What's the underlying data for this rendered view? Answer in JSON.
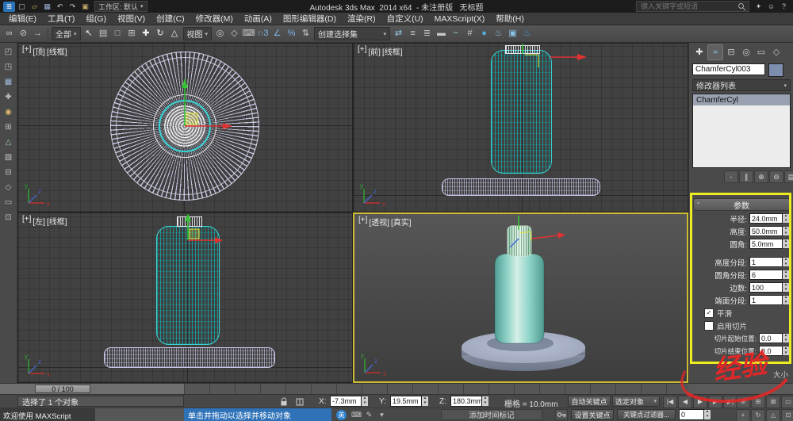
{
  "ui": {
    "caret": "▾",
    "spin_up": "▴",
    "spin_down": "▾",
    "minus": "-"
  },
  "titlebar": {
    "icons_left": [
      {
        "name": "app-menu-icon",
        "glyph": "≣",
        "color": "#ffffff",
        "bg": "#2a72b5"
      },
      {
        "name": "new-scene-icon",
        "glyph": "▢",
        "color": "#c8c8c8"
      },
      {
        "name": "open-file-icon",
        "glyph": "▱",
        "color": "#d8b868"
      },
      {
        "name": "save-icon",
        "glyph": "▦",
        "color": "#9ab0d0"
      },
      {
        "name": "undo-icon",
        "glyph": "↶",
        "color": "#c8c8c8"
      },
      {
        "name": "redo-icon",
        "glyph": "↷",
        "color": "#c8c8c8"
      },
      {
        "name": "fetch-icon",
        "glyph": "▣",
        "color": "#c0a868"
      }
    ],
    "workspace_label": "工作区: 默认",
    "title": "Autodesk 3ds Max  2014 x64  - 未注册版   无标题",
    "search_placeholder": "键入关键字或短语",
    "icons_right": [
      {
        "name": "sign-in-key-icon",
        "glyph": "✦",
        "color": "#c8c8c8"
      },
      {
        "name": "community-icon",
        "glyph": "☺",
        "color": "#c8c8c8"
      },
      {
        "name": "help-icon",
        "glyph": "?",
        "color": "#c8c8c8"
      }
    ]
  },
  "menubar": {
    "items": [
      "编辑(E)",
      "工具(T)",
      "组(G)",
      "视图(V)",
      "创建(C)",
      "修改器(M)",
      "动画(A)",
      "图形编辑器(D)",
      "渲染(R)",
      "自定义(U)",
      "MAXScript(X)",
      "帮助(H)"
    ]
  },
  "toolbar": {
    "icons_a": [
      {
        "name": "select-and-link-icon",
        "glyph": "∞",
        "color": "#c8c8c8"
      },
      {
        "name": "unlink-selection-icon",
        "glyph": "⊘",
        "color": "#c8c8c8"
      },
      {
        "name": "bind-to-space-warp-icon",
        "glyph": "→",
        "color": "#c8c8c8"
      }
    ],
    "selection_filter": "全部",
    "icons_b": [
      {
        "name": "select-object-icon",
        "glyph": "↖",
        "color": "#f0f0f0"
      },
      {
        "name": "select-by-name-icon",
        "glyph": "▤",
        "color": "#c8c8c8"
      },
      {
        "name": "rectangular-selection-region-icon",
        "glyph": "□",
        "color": "#c8c8c8"
      },
      {
        "name": "window-crossing-toggle-icon",
        "glyph": "⊞",
        "color": "#c8c8c8"
      },
      {
        "name": "select-and-move-icon",
        "glyph": "✚",
        "color": "#f0f0f0"
      },
      {
        "name": "select-and-rotate-icon",
        "glyph": "↻",
        "color": "#f0f0f0"
      },
      {
        "name": "select-and-scale-icon",
        "glyph": "△",
        "color": "#f0f0f0"
      }
    ],
    "reference_coordinate": "视图",
    "icons_c": [
      {
        "name": "use-pivot-center-icon",
        "glyph": "◎",
        "color": "#c8c8c8"
      },
      {
        "name": "select-and-manipulate-icon",
        "glyph": "◇",
        "color": "#c8c8c8"
      },
      {
        "name": "keyboard-shortcut-override-icon",
        "glyph": "⌨",
        "color": "#c8c8c8"
      },
      {
        "name": "snaps-toggle-icon",
        "glyph": "∩3",
        "color": "#7ab4e8"
      },
      {
        "name": "angle-snap-icon",
        "glyph": "∠",
        "color": "#7ab4e8"
      },
      {
        "name": "percent-snap-icon",
        "glyph": "%",
        "color": "#7ab4e8"
      },
      {
        "name": "spinner-snap-icon",
        "glyph": "⇅",
        "color": "#c8c8c8"
      }
    ],
    "named_selection": "创建选择集",
    "icons_d": [
      {
        "name": "mirror-icon",
        "glyph": "⇄",
        "color": "#9ad0e8"
      },
      {
        "name": "align-icon",
        "glyph": "≡",
        "color": "#c8c8c8"
      },
      {
        "name": "layer-manager-icon",
        "glyph": "≣",
        "color": "#c8c8c8"
      },
      {
        "name": "ribbon-toggle-icon",
        "glyph": "▬",
        "color": "#c8c8c8"
      },
      {
        "name": "curve-editor-icon",
        "glyph": "~",
        "color": "#9ae89a"
      },
      {
        "name": "schematic-view-icon",
        "glyph": "#",
        "color": "#c8c8c8"
      },
      {
        "name": "material-editor-icon",
        "glyph": "●",
        "color": "#58a8d8"
      },
      {
        "name": "render-setup-icon",
        "glyph": "♨",
        "color": "#88c0e8"
      },
      {
        "name": "rendered-frame-icon",
        "glyph": "▣",
        "color": "#88c0e8"
      },
      {
        "name": "render-production-icon",
        "glyph": "♨",
        "color": "#4a9ad8"
      }
    ]
  },
  "leftstrip": {
    "icons": [
      {
        "name": "left-dock-icon",
        "glyph": "◰",
        "color": "#c0c0c0"
      },
      {
        "name": "left-dock-icon",
        "glyph": "◳",
        "color": "#c0c0c0"
      },
      {
        "name": "left-dock-icon",
        "glyph": "▦",
        "color": "#9ab8d8"
      },
      {
        "name": "left-dock-icon",
        "glyph": "✚",
        "color": "#c0c0c0"
      },
      {
        "name": "left-dock-icon",
        "glyph": "◉",
        "color": "#d8b868"
      },
      {
        "name": "left-dock-icon",
        "glyph": "⊞",
        "color": "#c0c0c0"
      },
      {
        "name": "left-dock-icon",
        "glyph": "△",
        "color": "#9ad09a"
      },
      {
        "name": "left-dock-icon",
        "glyph": "▧",
        "color": "#c0c0c0"
      },
      {
        "name": "left-dock-icon",
        "glyph": "⊟",
        "color": "#c0c0c0"
      },
      {
        "name": "left-dock-icon",
        "glyph": "◇",
        "color": "#c0c0c0"
      },
      {
        "name": "left-dock-icon",
        "glyph": "▭",
        "color": "#c0c0c0"
      },
      {
        "name": "left-dock-icon",
        "glyph": "⊡",
        "color": "#c0c0c0"
      }
    ]
  },
  "viewports": {
    "top": {
      "plus": "[+]",
      "name": "[顶]",
      "shading": "[线框]"
    },
    "front": {
      "plus": "[+]",
      "name": "[前]",
      "shading": "[线框]"
    },
    "left": {
      "plus": "[+]",
      "name": "[左]",
      "shading": "[线框]"
    },
    "persp": {
      "plus": "[+]",
      "name": "[透视]",
      "shading": "[真实]"
    }
  },
  "axes": {
    "x": "x",
    "y": "y",
    "z": "z"
  },
  "cmdpanel": {
    "tabs": [
      {
        "name": "create-tab-icon",
        "glyph": "✚",
        "color": "#e8e8e8"
      },
      {
        "name": "modify-tab-icon",
        "glyph": "≈",
        "color": "#8fd0f0",
        "active": true
      },
      {
        "name": "hierarchy-tab-icon",
        "glyph": "⊟",
        "color": "#c8c8c8"
      },
      {
        "name": "motion-tab-icon",
        "glyph": "◎",
        "color": "#c8c8c8"
      },
      {
        "name": "display-tab-icon",
        "glyph": "▭",
        "color": "#c8c8c8"
      },
      {
        "name": "utilities-tab-icon",
        "glyph": "◇",
        "color": "#c8c8c8"
      }
    ],
    "object_name": "ChamferCyl003",
    "modifier_list_label": "修改器列表",
    "stack_items": [
      "ChamferCyl"
    ],
    "stack_buttons": [
      {
        "name": "pin-stack-button",
        "glyph": "-",
        "color": "#d8d8d8"
      },
      {
        "name": "show-end-result-button",
        "glyph": "∥",
        "color": "#d8d8d8"
      },
      {
        "name": "make-unique-button",
        "glyph": "⊕",
        "color": "#d8d8d8"
      },
      {
        "name": "remove-modifier-button",
        "glyph": "⊖",
        "color": "#d8d8d8"
      },
      {
        "name": "configure-modifier-sets-button",
        "glyph": "▤",
        "color": "#d8d8d8"
      }
    ],
    "params": {
      "rollout_title": "参数",
      "fields": [
        {
          "label": "半径:",
          "value": "24.0mm"
        },
        {
          "label": "高度:",
          "value": "50.0mm"
        },
        {
          "label": "圆角:",
          "value": "5.0mm"
        },
        {
          "label": "高度分段:",
          "value": "1"
        },
        {
          "label": "圆角分段:",
          "value": "6"
        },
        {
          "label": "边数:",
          "value": "100"
        },
        {
          "label": "端面分段:",
          "value": "1"
        }
      ],
      "checkboxes": [
        {
          "label": "平滑",
          "checked": "✓"
        },
        {
          "label": "启用切片",
          "checked": ""
        }
      ],
      "slice_fields": [
        {
          "label": "切片起始位置:",
          "value": "0.0"
        },
        {
          "label": "切片结束位置:",
          "value": "0.0"
        }
      ]
    },
    "bottom_fragment": "大小"
  },
  "timebar": {
    "slider_label": "0 / 100"
  },
  "statusbar": {
    "selection_text": "选择了 1 个对象",
    "coord": {
      "x_label": "X:",
      "x": "-7.3mm",
      "y_label": "Y:",
      "y": "19.5mm",
      "z_label": "Z:",
      "z": "180.3mm"
    },
    "grid_text": "栅格 = 10.0mm",
    "auto_key": "自动关键点",
    "selected_mode": "选定对象",
    "playback": [
      {
        "name": "goto-start-button",
        "glyph": "|◀",
        "color": "#d8d8d8"
      },
      {
        "name": "prev-frame-button",
        "glyph": "◀",
        "color": "#d8d8d8"
      },
      {
        "name": "play-button",
        "glyph": "▶",
        "color": "#d8d8d8"
      },
      {
        "name": "next-frame-button",
        "glyph": "▶",
        "color": "#d8d8d8"
      },
      {
        "name": "goto-end-button",
        "glyph": "▶|",
        "color": "#d8d8d8"
      }
    ],
    "nav_row1": [
      {
        "name": "zoom-icon",
        "glyph": "⊕",
        "color": "#c8c8c8"
      },
      {
        "name": "zoom-all-icon",
        "glyph": "⊞",
        "color": "#c8c8c8"
      },
      {
        "name": "zoom-extents-icon",
        "glyph": "⊠",
        "color": "#c8c8c8"
      },
      {
        "name": "zoom-region-icon",
        "glyph": "▭",
        "color": "#c8c8c8"
      }
    ]
  },
  "promptbar": {
    "maxscript_text": "欢迎使用 MAXScript",
    "prompt_text": "单击并拖动以选择并移动对象",
    "ime_badge": "英",
    "ime_icons": [
      {
        "name": "ime-keyboard-icon",
        "glyph": "⌨",
        "color": "#c8c8c8"
      },
      {
        "name": "ime-pen-icon",
        "glyph": "✎",
        "color": "#c8c8c8"
      },
      {
        "name": "ime-settings-icon",
        "glyph": "▾",
        "color": "#c8c8c8"
      }
    ],
    "time_tag": "添加时间标记",
    "set_key": "设置关键点",
    "key_filters": "关键点过滤器...",
    "frame_value": "0",
    "nav_row2": [
      {
        "name": "pan-icon",
        "glyph": "+",
        "color": "#c8c8c8"
      },
      {
        "name": "orbit-icon",
        "glyph": "↻",
        "color": "#c8c8c8"
      },
      {
        "name": "fov-icon",
        "glyph": "△",
        "color": "#c8c8c8"
      },
      {
        "name": "maximize-viewport-icon",
        "glyph": "⊡",
        "color": "#c8c8c8"
      }
    ]
  },
  "watermark": "经验"
}
